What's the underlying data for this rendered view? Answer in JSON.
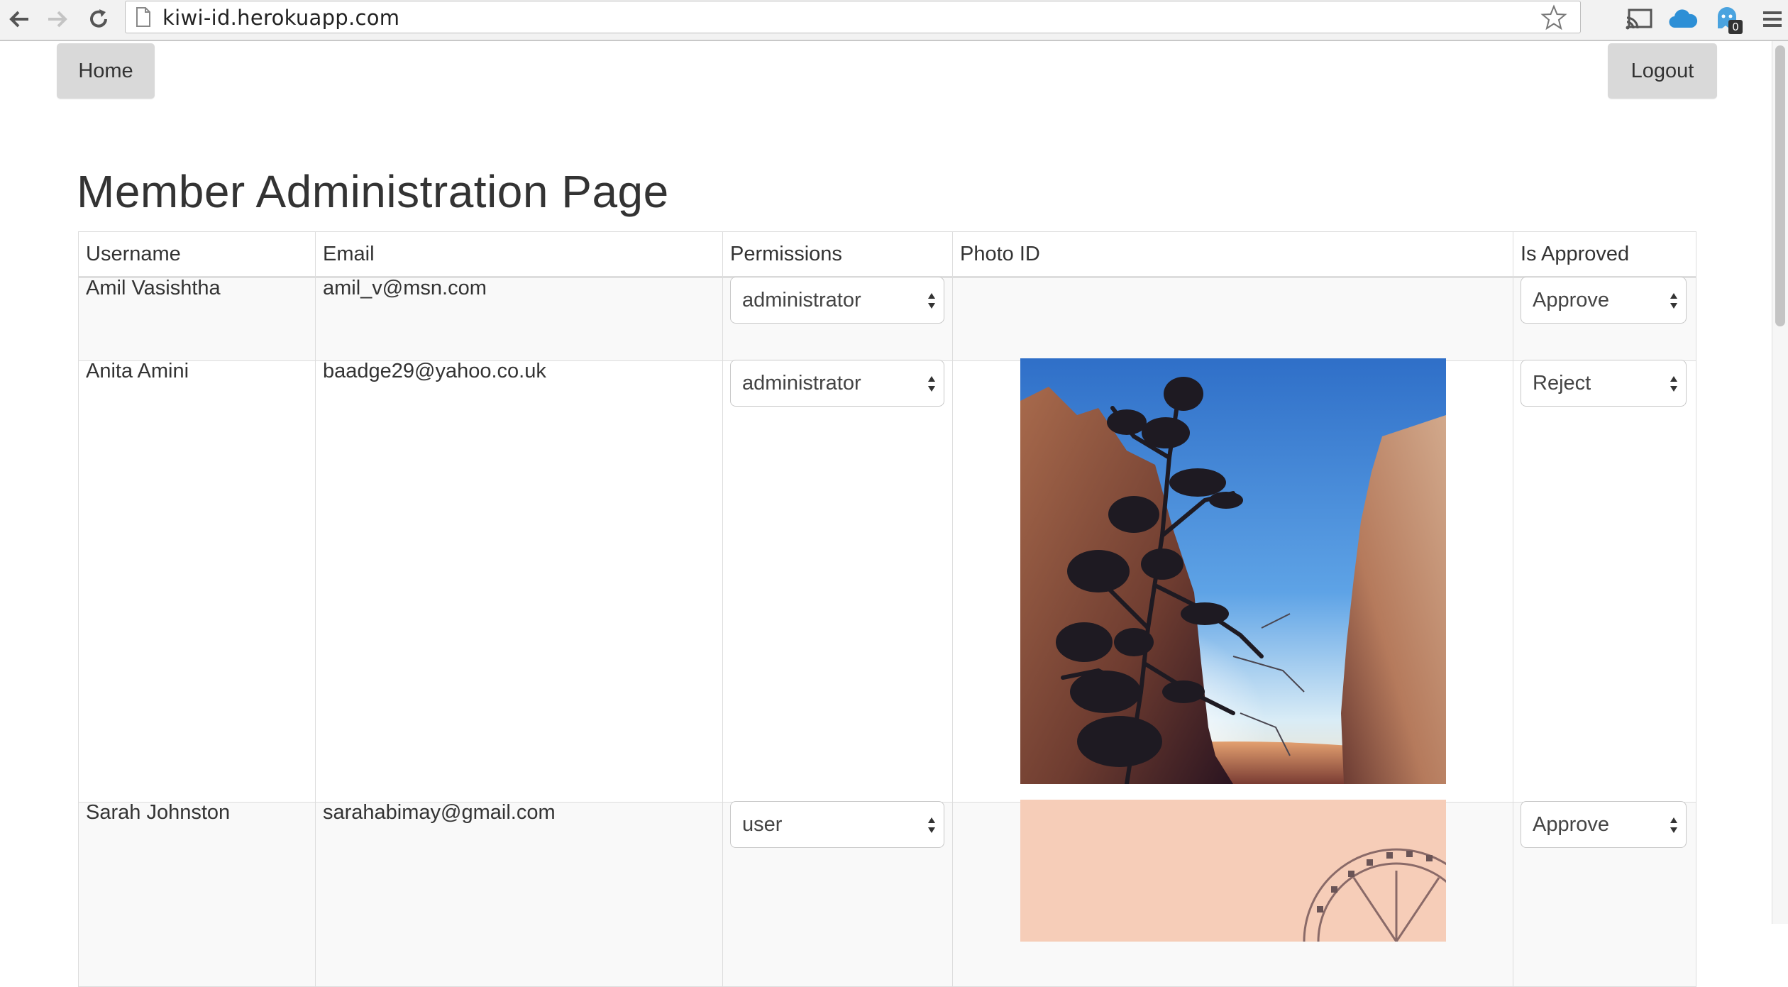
{
  "browser": {
    "url": "kiwi-id.herokuapp.com",
    "extension_badge": "0"
  },
  "nav": {
    "home_label": "Home",
    "logout_label": "Logout"
  },
  "page": {
    "title": "Member Administration Page"
  },
  "table": {
    "headers": {
      "username": "Username",
      "email": "Email",
      "permissions": "Permissions",
      "photo_id": "Photo ID",
      "is_approved": "Is Approved"
    },
    "rows": [
      {
        "username": "Amil Vasishtha",
        "email": "amil_v@msn.com",
        "permissions": "administrator",
        "approved": "Approve"
      },
      {
        "username": "Anita Amini",
        "email": "baadge29@yahoo.co.uk",
        "permissions": "administrator",
        "approved": "Reject"
      },
      {
        "username": "Sarah Johnston",
        "email": "sarahabimay@gmail.com",
        "permissions": "user",
        "approved": "Approve"
      }
    ]
  }
}
